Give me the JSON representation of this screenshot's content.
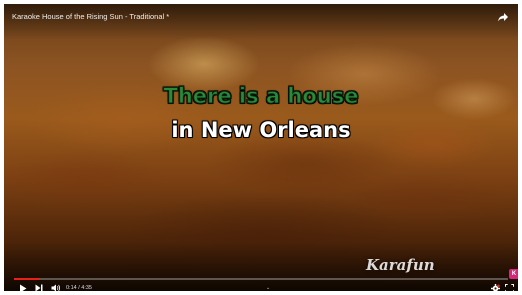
{
  "video": {
    "title": "Karaoke House of the Rising Sun - Traditional *",
    "share_icon": "share-arrow-icon"
  },
  "lyrics": {
    "line1": "There is a house",
    "line2": "in New Orleans",
    "sung_color": "#2a8a3c",
    "unsung_color": "#ffffff"
  },
  "brand": {
    "name": "Karafun"
  },
  "player": {
    "time_display": "0:14 / 4:35",
    "progress": 0.052,
    "accent": "#e62117",
    "controls": {
      "play_icon": "play-icon",
      "next_icon": "next-icon",
      "volume_icon": "volume-icon",
      "chevron_icon": "chevron-down-icon",
      "settings_icon": "settings-icon",
      "fullscreen_icon": "fullscreen-icon"
    },
    "badge_label": "K",
    "badge_color": "#d6257a"
  }
}
